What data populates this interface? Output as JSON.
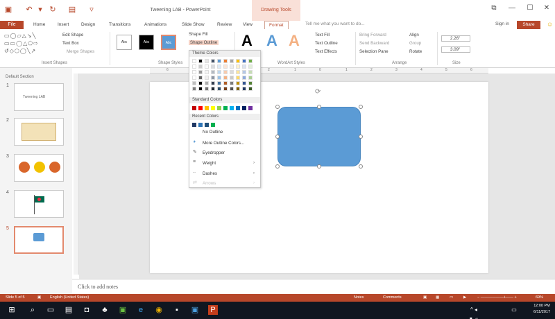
{
  "window": {
    "title": "Tweening LAB - PowerPoint",
    "context_tab_header": "Drawing Tools",
    "controls": {
      "restore": "⧉",
      "minimize": "—",
      "maximize": "☐",
      "close": "✕"
    }
  },
  "tabs": {
    "file": "File",
    "items": [
      "Home",
      "Insert",
      "Design",
      "Transitions",
      "Animations",
      "Slide Show",
      "Review",
      "View",
      "Format"
    ],
    "active": "Format",
    "tell_me": "Tell me what you want to do...",
    "sign_in": "Sign in",
    "share": "Share"
  },
  "ribbon": {
    "insert_shapes": {
      "label": "Insert Shapes",
      "edit_shape": "Edit Shape",
      "text_box": "Text Box",
      "merge_shapes": "Merge Shapes"
    },
    "shape_styles": {
      "label": "Shape Styles",
      "thumb_text": "Abc",
      "shape_fill": "Shape Fill",
      "shape_outline": "Shape Outline"
    },
    "wordart_styles": {
      "label": "WordArt Styles",
      "letter": "A",
      "text_fill": "Text Fill",
      "text_outline": "Text Outline",
      "text_effects": "Text Effects"
    },
    "arrange": {
      "label": "Arrange",
      "bring_forward": "Bring Forward",
      "send_backward": "Send Backward",
      "selection_pane": "Selection Pane",
      "align": "Align",
      "group": "Group",
      "rotate": "Rotate"
    },
    "size": {
      "label": "Size",
      "height": "2.26\"",
      "width": "3.09\""
    }
  },
  "ruler": {
    "numbers": [
      "6",
      "5",
      "4",
      "3",
      "2",
      "1",
      "0",
      "1",
      "2",
      "3",
      "4",
      "5",
      "6"
    ]
  },
  "thumbnails": {
    "section": "Default Section",
    "slides": [
      {
        "num": "1",
        "title": "Tweening LAB"
      },
      {
        "num": "2",
        "title": ""
      },
      {
        "num": "3",
        "title": ""
      },
      {
        "num": "4",
        "title": ""
      },
      {
        "num": "5",
        "title": ""
      }
    ],
    "selected": "5"
  },
  "notes": {
    "placeholder": "Click to add notes"
  },
  "outline_menu": {
    "theme_colors": "Theme Colors",
    "standard_colors": "Standard Colors",
    "recent_colors": "Recent Colors",
    "no_outline": "No Outline",
    "more_colors": "More Outline Colors...",
    "eyedropper": "Eyedropper",
    "weight": "Weight",
    "dashes": "Dashes",
    "arrows": "Arrows",
    "theme_top": [
      "#ffffff",
      "#000000",
      "#e7e6e6",
      "#44546a",
      "#5b9bd5",
      "#ed7d31",
      "#a5a5a5",
      "#ffc000",
      "#4472c4",
      "#70ad47"
    ],
    "standard": [
      "#c00000",
      "#ff0000",
      "#ffc000",
      "#ffff00",
      "#92d050",
      "#00b050",
      "#00b0f0",
      "#0070c0",
      "#002060",
      "#7030a0"
    ],
    "recent": [
      "#1f3864",
      "#2e75b6",
      "#1f4e79",
      "#00b050"
    ]
  },
  "statusbar": {
    "slide_info": "Slide 5 of 5",
    "language": "English (United States)",
    "notes": "Notes",
    "comments": "Comments",
    "zoom": "69%"
  },
  "taskbar": {
    "time": "12:00 PM",
    "date": "6/11/2017"
  },
  "colors": {
    "accent": "#b7472a",
    "shape_fill": "#5b9bd5"
  }
}
